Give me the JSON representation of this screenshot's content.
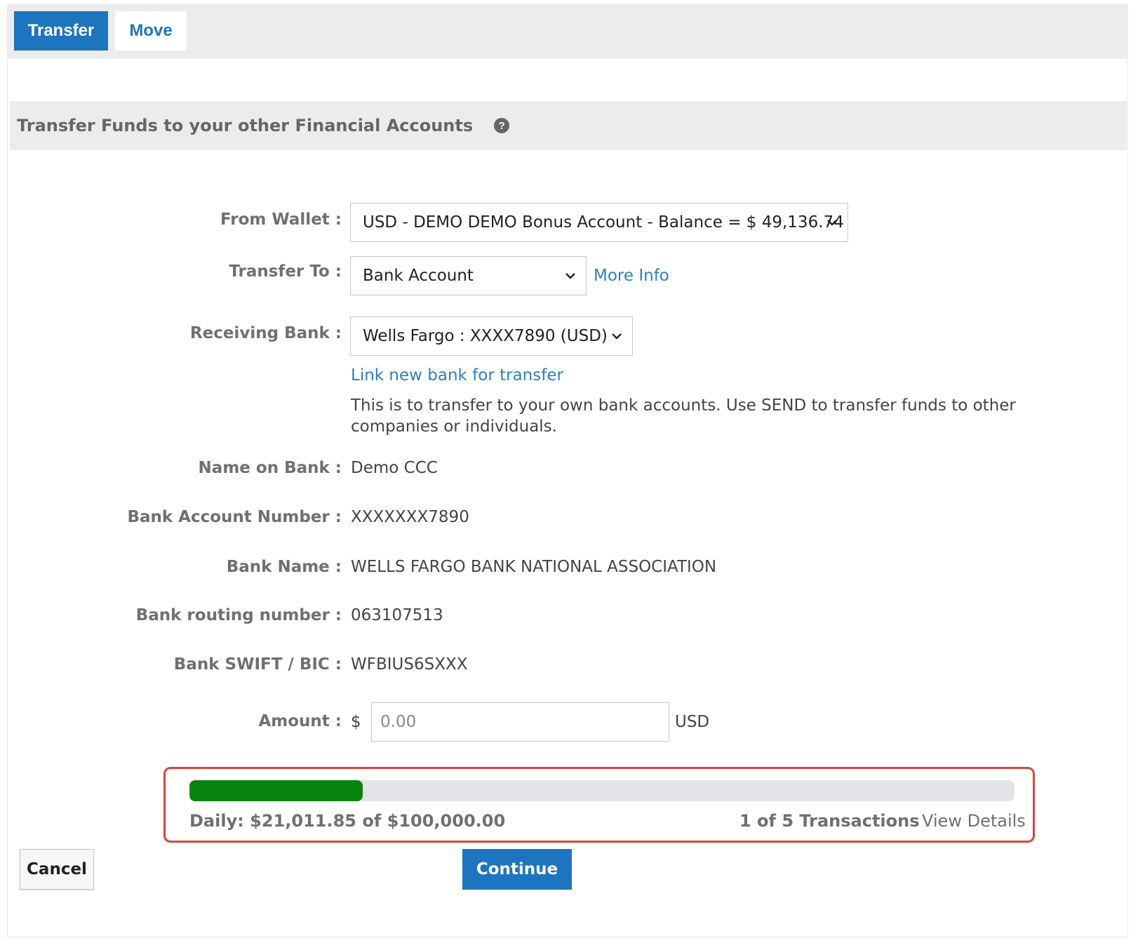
{
  "tabs": [
    {
      "label": "Transfer",
      "active": true
    },
    {
      "label": "Move",
      "active": false
    }
  ],
  "section": {
    "title": "Transfer Funds to your other Financial Accounts",
    "help_icon": "question-circle-icon"
  },
  "form": {
    "from_wallet": {
      "label": "From Wallet :",
      "value": "USD - DEMO DEMO Bonus Account - Balance = $ 49,136.74"
    },
    "transfer_to": {
      "label": "Transfer To :",
      "value": "Bank Account",
      "more_info": "More Info"
    },
    "receiving_bank": {
      "label": "Receiving Bank :",
      "value": "Wells Fargo : XXXX7890 (USD)"
    },
    "link_new_bank": "Link new bank for transfer",
    "help_text": "This is to transfer to your own bank accounts. Use SEND to transfer funds to other companies or individuals.",
    "name_on_bank": {
      "label": "Name on Bank :",
      "value": "Demo CCC"
    },
    "bank_account_number": {
      "label": "Bank Account Number :",
      "value": "XXXXXXX7890"
    },
    "bank_name": {
      "label": "Bank Name :",
      "value": "WELLS FARGO BANK NATIONAL ASSOCIATION"
    },
    "bank_routing_number": {
      "label": "Bank routing number :",
      "value": "063107513"
    },
    "bank_swift": {
      "label": "Bank SWIFT / BIC :",
      "value": "WFBIUS6SXXX"
    },
    "amount": {
      "label": "Amount :",
      "currency_symbol": "$",
      "placeholder": "0.00",
      "currency": "USD"
    }
  },
  "limits": {
    "daily_text": "Daily: $21,011.85 of $100,000.00",
    "progress_fraction": 0.21,
    "transactions_text": "1 of 5 Transactions",
    "view_details": "View Details"
  },
  "buttons": {
    "cancel": "Cancel",
    "continue": "Continue"
  },
  "colors": {
    "primary": "#1e75bf",
    "link": "#2f7fc2",
    "progress": "#07840e",
    "highlight_border": "#d9453a"
  }
}
